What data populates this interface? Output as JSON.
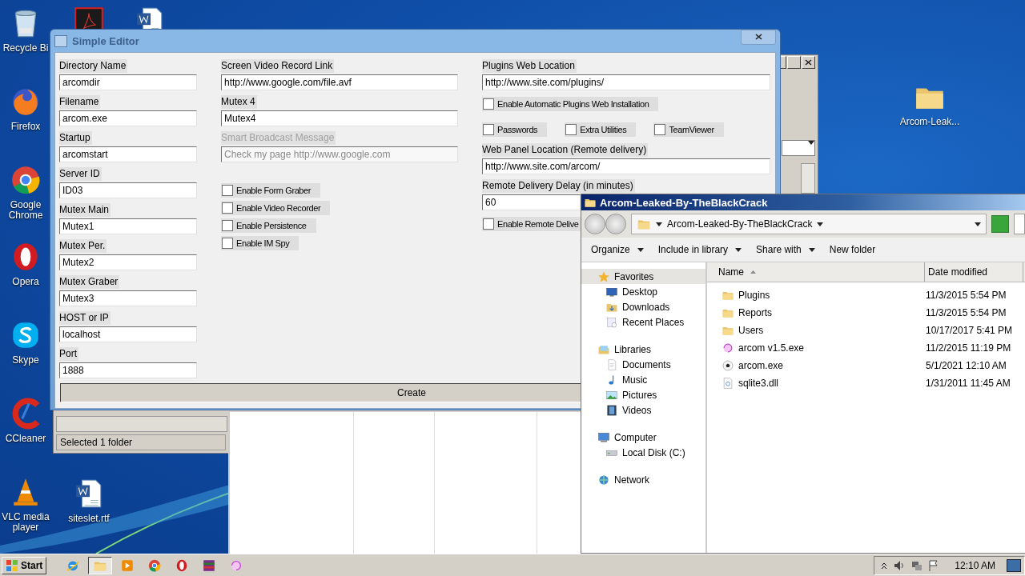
{
  "desktop_icons": [
    {
      "kind": "recycle",
      "label": "Recycle Bi"
    },
    {
      "kind": "firefox",
      "label": "Firefox"
    },
    {
      "kind": "chrome",
      "label": "Google Chrome"
    },
    {
      "kind": "opera",
      "label": "Opera"
    },
    {
      "kind": "skype",
      "label": "Skype"
    },
    {
      "kind": "ccleaner",
      "label": "CCleaner"
    },
    {
      "kind": "vlc",
      "label": "VLC media player"
    },
    {
      "kind": "acrobat"
    },
    {
      "kind": "word"
    },
    {
      "kind": "word",
      "label": "siteslet.rtf"
    },
    {
      "kind": "folder",
      "label": "Arcom-Leak..."
    }
  ],
  "background_window": {
    "status": "Selected 1 folder"
  },
  "editor": {
    "title": "Simple Editor",
    "columns": [
      {
        "items": [
          {
            "kind": "field",
            "label": "Directory Name",
            "value": "arcomdir",
            "disabled": false
          },
          {
            "kind": "field",
            "label": "Filename",
            "value": "arcom.exe",
            "disabled": false
          },
          {
            "kind": "field",
            "label": "Startup",
            "value": "arcomstart",
            "disabled": false
          },
          {
            "kind": "field",
            "label": "Server ID",
            "value": "ID03",
            "disabled": false
          },
          {
            "kind": "field",
            "label": "Mutex Main",
            "value": "Mutex1",
            "disabled": false
          },
          {
            "kind": "field",
            "label": "Mutex Per.",
            "value": "Mutex2",
            "disabled": false
          },
          {
            "kind": "field",
            "label": "Mutex Graber",
            "value": "Mutex3",
            "disabled": false
          },
          {
            "kind": "field",
            "label": "HOST or IP",
            "value": "localhost",
            "disabled": false
          },
          {
            "kind": "field",
            "label": "Port",
            "value": "1888",
            "disabled": false
          }
        ]
      },
      {
        "items": [
          {
            "kind": "field",
            "label": "Screen Video Record Link",
            "value": "http://www.google.com/file.avf",
            "disabled": false
          },
          {
            "kind": "field",
            "label": "Mutex 4",
            "value": "Mutex4",
            "disabled": false
          },
          {
            "kind": "field",
            "label": "Smart Broadcast  Message",
            "value": "Check my page http://www.google.com",
            "disabled": true
          },
          {
            "kind": "checkbox",
            "label": "Enable Form Graber",
            "checked": false
          },
          {
            "kind": "checkbox",
            "label": "Enable Video Recorder",
            "checked": false
          },
          {
            "kind": "checkbox",
            "label": "Enable Persistence",
            "checked": false
          },
          {
            "kind": "checkbox",
            "label": "Enable IM Spy",
            "checked": false
          }
        ]
      },
      {
        "items": [
          {
            "kind": "field",
            "label": "Plugins Web Location",
            "value": "http://www.site.com/plugins/",
            "disabled": false
          },
          {
            "kind": "checkbox",
            "label": "Enable Automatic Plugins Web Installation",
            "checked": false
          },
          {
            "kind": "checkbox_row",
            "options": [
              {
                "label": "Passwords",
                "checked": false
              },
              {
                "label": "Extra Utilities",
                "checked": false
              },
              {
                "label": "TeamViewer",
                "checked": false
              }
            ]
          },
          {
            "kind": "field",
            "label": "Web Panel Location (Remote delivery)",
            "value": "http://www.site.com/arcom/",
            "disabled": false
          },
          {
            "kind": "field",
            "label": "Remote Delivery Delay (in minutes)",
            "value": "60",
            "disabled": false
          },
          {
            "kind": "checkbox",
            "label": "Enable Remote Delive",
            "checked": false
          }
        ]
      }
    ],
    "create_button": "Create"
  },
  "explorer": {
    "title": "Arcom-Leaked-By-TheBlackCrack",
    "address": "Arcom-Leaked-By-TheBlackCrack",
    "toolbar": [
      {
        "label": "Organize",
        "dropdown": true
      },
      {
        "label": "Include in library",
        "dropdown": true
      },
      {
        "label": "Share with",
        "dropdown": true
      },
      {
        "label": "New folder",
        "dropdown": false
      }
    ],
    "nav": [
      {
        "label": "Favorites",
        "kind": "star",
        "selected": true,
        "children": [
          {
            "label": "Desktop",
            "kind": "desktop",
            "selected": false
          },
          {
            "label": "Downloads",
            "kind": "downloads",
            "selected": false
          },
          {
            "label": "Recent Places",
            "kind": "recent",
            "selected": false
          }
        ]
      },
      {
        "label": "Libraries",
        "kind": "libraries",
        "selected": false,
        "children": [
          {
            "label": "Documents",
            "kind": "documents",
            "selected": false
          },
          {
            "label": "Music",
            "kind": "music",
            "selected": false
          },
          {
            "label": "Pictures",
            "kind": "pictures",
            "selected": false
          },
          {
            "label": "Videos",
            "kind": "videos",
            "selected": false
          }
        ]
      },
      {
        "label": "Computer",
        "kind": "computer",
        "selected": false,
        "children": [
          {
            "label": "Local Disk (C:)",
            "kind": "disk",
            "selected": false
          }
        ]
      },
      {
        "label": "Network",
        "kind": "network",
        "selected": false
      }
    ],
    "columns": [
      {
        "label": "Name",
        "sorted": true
      },
      {
        "label": "Date modified",
        "sorted": false
      }
    ],
    "files": [
      {
        "name": "Plugins",
        "date": "11/3/2015 5:54 PM",
        "kind": "folder"
      },
      {
        "name": "Reports",
        "date": "11/3/2015 5:54 PM",
        "kind": "folder"
      },
      {
        "name": "Users",
        "date": "10/17/2017 5:41 PM",
        "kind": "folder"
      },
      {
        "name": "arcom v1.5.exe",
        "date": "11/2/2015 11:19 PM",
        "kind": "swirl"
      },
      {
        "name": "arcom.exe",
        "date": "5/1/2021 12:10 AM",
        "kind": "ball"
      },
      {
        "name": "sqlite3.dll",
        "date": "1/31/2011 11:45 AM",
        "kind": "dll"
      }
    ]
  },
  "taskbar": {
    "start": "Start",
    "apps": [
      {
        "kind": "ie",
        "selected": false
      },
      {
        "kind": "explorer",
        "selected": true
      },
      {
        "kind": "media",
        "selected": false
      },
      {
        "kind": "chrome",
        "selected": false
      },
      {
        "kind": "opera",
        "selected": false
      },
      {
        "kind": "winrar",
        "selected": false
      },
      {
        "kind": "swirl",
        "selected": false
      }
    ],
    "clock": "12:10 AM"
  }
}
